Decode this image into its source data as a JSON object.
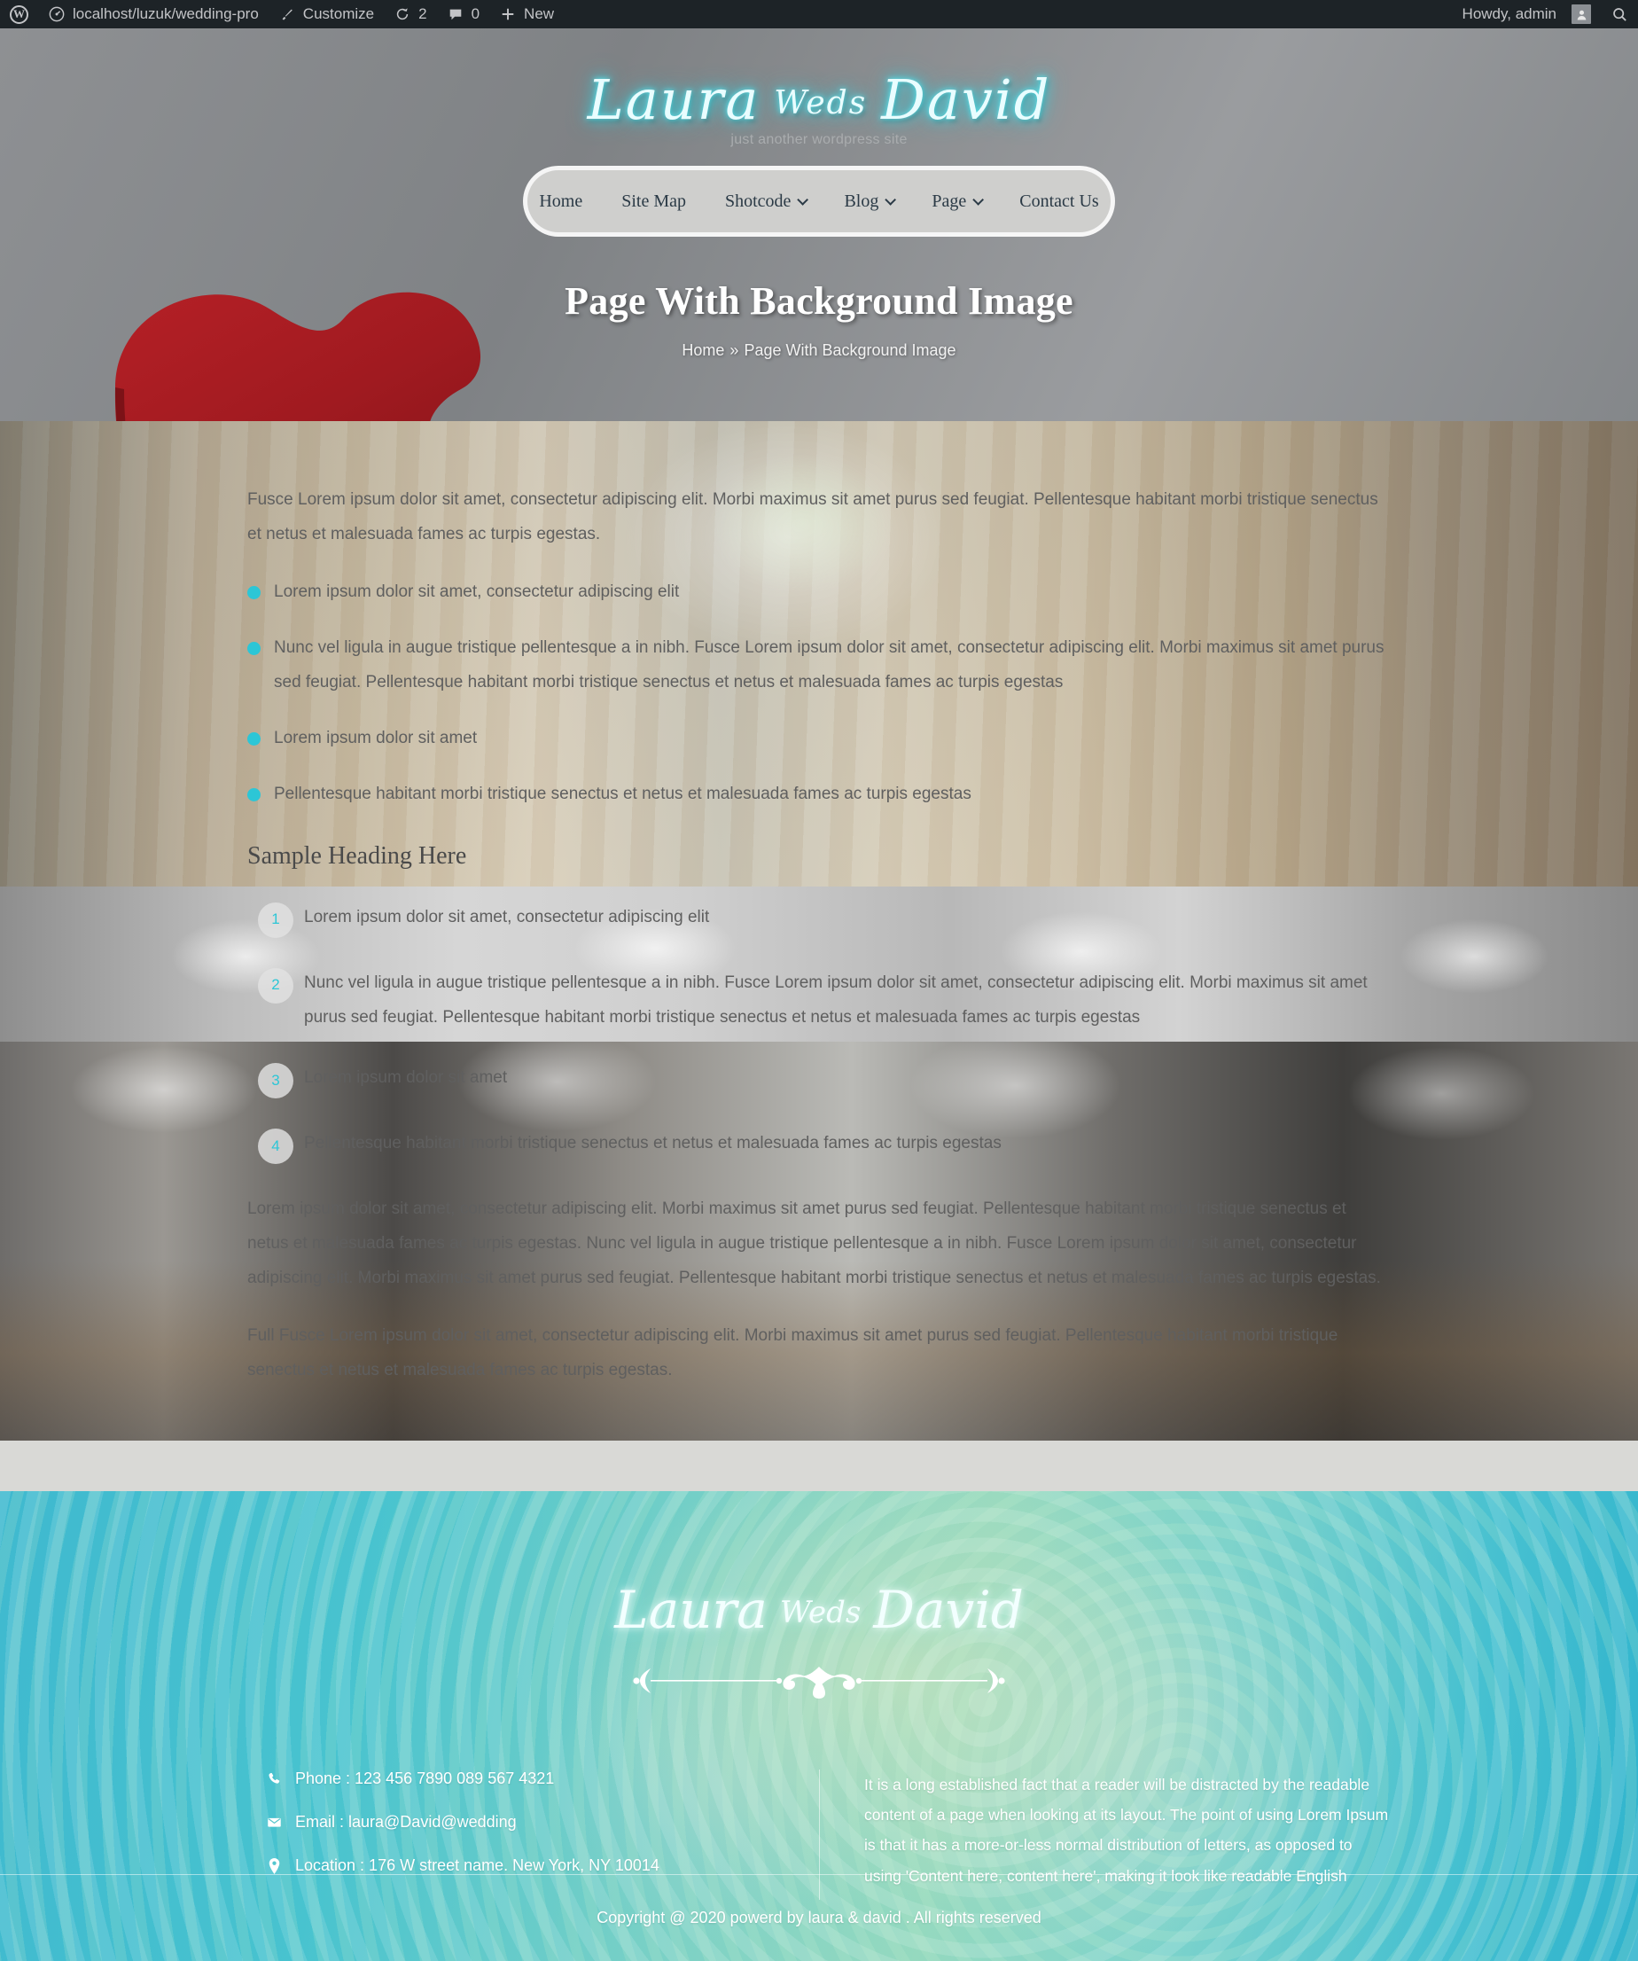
{
  "adminbar": {
    "site_name": "localhost/luzuk/wedding-pro",
    "customize": "Customize",
    "updates_count": "2",
    "comments_count": "0",
    "new": "New",
    "howdy": "Howdy, admin"
  },
  "header": {
    "site_title_first": "Laura",
    "site_title_weds": "Weds",
    "site_title_last": "David",
    "tagline": "just another wordpress site",
    "menu": [
      {
        "label": "Home",
        "has_submenu": false
      },
      {
        "label": "Site Map",
        "has_submenu": false
      },
      {
        "label": "Shotcode",
        "has_submenu": true
      },
      {
        "label": "Blog",
        "has_submenu": true
      },
      {
        "label": "Page",
        "has_submenu": true
      },
      {
        "label": "Contact Us",
        "has_submenu": false
      }
    ],
    "page_title": "Page With Background Image",
    "breadcrumb_home": "Home",
    "breadcrumb_sep": "»",
    "breadcrumb_current": "Page With Background Image"
  },
  "main": {
    "intro": "Fusce Lorem ipsum dolor sit amet, consectetur adipiscing elit. Morbi maximus sit amet purus sed feugiat. Pellentesque habitant morbi tristique senectus et netus et malesuada fames ac turpis egestas.",
    "bullets": [
      "Lorem ipsum dolor sit amet, consectetur adipiscing elit",
      "Nunc vel ligula in augue tristique pellentesque a in nibh. Fusce Lorem ipsum dolor sit amet, consectetur adipiscing elit. Morbi maximus sit amet purus sed feugiat. Pellentesque habitant morbi tristique senectus et netus et malesuada fames ac turpis egestas",
      "Lorem ipsum dolor sit amet",
      "Pellentesque habitant morbi tristique senectus et netus et malesuada fames ac turpis egestas"
    ],
    "sample_heading": "Sample Heading Here",
    "numbered": [
      {
        "n": "1",
        "text": "Lorem ipsum dolor sit amet, consectetur adipiscing elit"
      },
      {
        "n": "2",
        "text": "Nunc vel ligula in augue tristique pellentesque a in nibh. Fusce Lorem ipsum dolor sit amet, consectetur adipiscing elit. Morbi maximus sit amet purus sed feugiat. Pellentesque habitant morbi tristique senectus et netus et malesuada fames ac turpis egestas"
      },
      {
        "n": "3",
        "text": "Lorem ipsum dolor sit amet"
      },
      {
        "n": "4",
        "text": "Pellentesque habitant morbi tristique senectus et netus et malesuada fames ac turpis egestas"
      }
    ],
    "para_2": "Lorem ipsum dolor sit amet, consectetur adipiscing elit. Morbi maximus sit amet purus sed feugiat. Pellentesque habitant morbi tristique senectus et netus et malesuada fames ac turpis egestas. Nunc vel ligula in augue tristique pellentesque a in nibh. Fusce Lorem ipsum dolor sit amet, consectetur adipiscing elit. Morbi maximus sit amet purus sed feugiat. Pellentesque habitant morbi tristique senectus et netus et malesuada fames ac turpis egestas.",
    "para_3": "Full Fusce Lorem ipsum dolor sit amet, consectetur adipiscing elit. Morbi maximus sit amet purus sed feugiat. Pellentesque habitant morbi tristique senectus et netus et malesuada fames ac turpis egestas."
  },
  "footer": {
    "title_first": "Laura",
    "title_weds": "Weds",
    "title_last": "David",
    "phone": "Phone : 123 456 7890 089 567 4321",
    "email": "Email : laura@David@wedding",
    "location": "Location : 176 W street name. New York, NY 10014",
    "about": "It is a long established fact that a reader will be distracted by the readable content of a page when looking at its layout. The point of using Lorem Ipsum is that it has a more-or-less normal distribution of letters, as opposed to using 'Content here, content here', making it look like readable English",
    "copyright": "Copyright @ 2020 powerd by laura & david . All rights reserved"
  },
  "colors": {
    "accent": "#2cc6d6",
    "adminbar_bg": "#1d2327",
    "footer_teal": "#3fb9cf",
    "nav_pill": "#cfcfcd"
  }
}
